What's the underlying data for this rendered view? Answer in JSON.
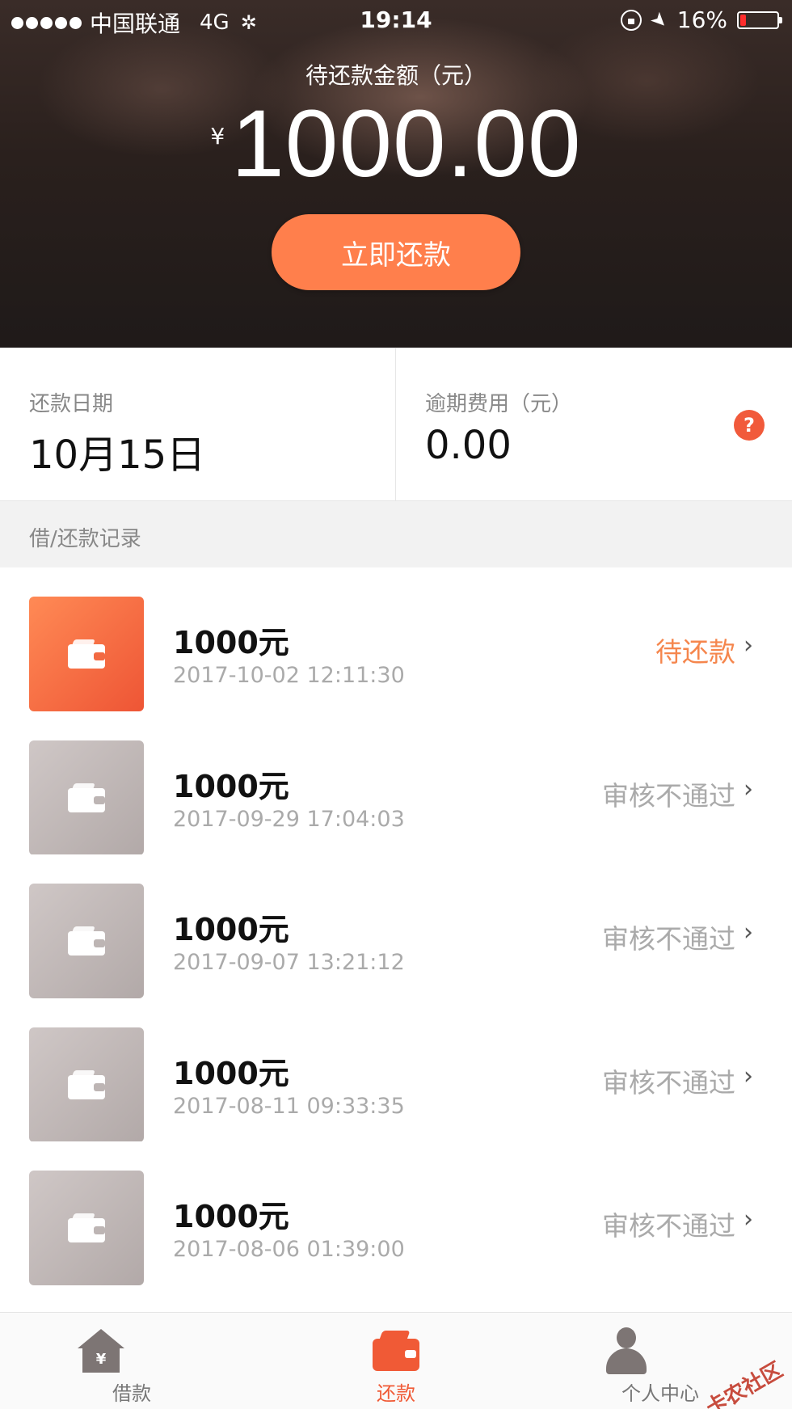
{
  "status_bar": {
    "carrier": "中国联通",
    "network": "4G",
    "time": "19:14",
    "battery": "16%",
    "battery_level": 0.16
  },
  "hero": {
    "label": "待还款金额（元）",
    "currency": "¥",
    "amount": "1000.00",
    "repay_button": "立即还款"
  },
  "info": {
    "due_date_label": "还款日期",
    "due_date_value": "10月15日",
    "overdue_label": "逾期费用（元）",
    "overdue_value": "0.00",
    "help_icon": "?"
  },
  "records_section": {
    "title": "借/还款记录"
  },
  "records": [
    {
      "amount": "1000元",
      "date": "2017-10-02 12:11:30",
      "status": "待还款"
    },
    {
      "amount": "1000元",
      "date": "2017-09-29 17:04:03",
      "status": "审核不通过"
    },
    {
      "amount": "1000元",
      "date": "2017-09-07 13:21:12",
      "status": "审核不通过"
    },
    {
      "amount": "1000元",
      "date": "2017-08-11 09:33:35",
      "status": "审核不通过"
    },
    {
      "amount": "1000元",
      "date": "2017-08-06 01:39:00",
      "status": "审核不通过"
    }
  ],
  "tabbar": {
    "loan": "借款",
    "loan_icon_glyph": "¥",
    "repay": "还款",
    "profile": "个人中心"
  },
  "watermark": "卡农社区",
  "colors": {
    "accent": "#ff7f4c",
    "active_tab": "#f05a36",
    "pending_status": "#f5864d",
    "rejected_status": "#aaaaaa"
  }
}
